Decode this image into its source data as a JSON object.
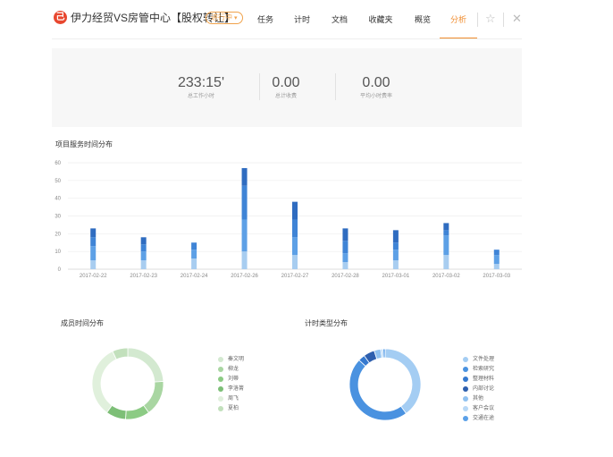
{
  "header": {
    "logo_text": "己",
    "title": "伊力经贸VS房管中心【股权转让】",
    "status": "进行中",
    "tabs": [
      {
        "label": "任务",
        "active": false
      },
      {
        "label": "计时",
        "active": false
      },
      {
        "label": "文档",
        "active": false
      },
      {
        "label": "收藏夹",
        "active": false
      },
      {
        "label": "概览",
        "active": false
      },
      {
        "label": "分析",
        "active": true
      }
    ],
    "star_icon": "star-icon",
    "close_icon": "close-icon"
  },
  "stats": [
    {
      "value": "233:15'",
      "label": "总工作小时"
    },
    {
      "value": "0.00",
      "label": "总计收费"
    },
    {
      "value": "0.00",
      "label": "平均小时费率"
    }
  ],
  "service_chart": {
    "title": "项目服务时间分布",
    "chart_data": {
      "type": "bar",
      "stacked": true,
      "categories": [
        "2017-02-22",
        "2017-02-23",
        "2017-02-24",
        "2017-02-26",
        "2017-02-27",
        "2017-02-28",
        "2017-03-01",
        "2017-03-02",
        "2017-03-03"
      ],
      "y_ticks": [
        0,
        10,
        20,
        30,
        40,
        50,
        60
      ],
      "ylim": [
        0,
        60
      ],
      "grid": true,
      "colors": [
        "#a8cdf0",
        "#5da0e6",
        "#3f84d6",
        "#2f6cc0"
      ],
      "series": [
        {
          "values": [
            5,
            5,
            6,
            10,
            8,
            4,
            5,
            8,
            3
          ]
        },
        {
          "values": [
            8,
            5,
            5,
            18,
            10,
            5,
            6,
            11,
            5
          ]
        },
        {
          "values": [
            5,
            4,
            4,
            19,
            10,
            7,
            4,
            3,
            3
          ]
        },
        {
          "values": [
            5,
            4,
            0,
            10,
            10,
            7,
            7,
            4,
            0
          ]
        }
      ]
    }
  },
  "member_chart": {
    "title": "成员时间分布",
    "chart_data": {
      "type": "pie",
      "donut": true,
      "categories": [
        "秦文明",
        "柳龙",
        "刘蒂",
        "李洛箐",
        "周飞",
        "夏柏"
      ],
      "values": [
        24,
        16,
        11,
        9,
        33,
        7
      ],
      "colors": [
        "#d3e9d0",
        "#a9d6a2",
        "#8ccb84",
        "#7dbf77",
        "#e0f0dc",
        "#c2e0bc"
      ]
    }
  },
  "type_chart": {
    "title": "计时类型分布",
    "chart_data": {
      "type": "pie",
      "donut": true,
      "categories": [
        "文件处理",
        "检索研究",
        "整理材料",
        "内部讨论",
        "其他",
        "客户会议",
        "交通在途"
      ],
      "values": [
        40,
        47,
        3,
        5,
        3,
        1,
        1
      ],
      "colors": [
        "#a4cdf3",
        "#4a92e0",
        "#3579cf",
        "#2e5fae",
        "#90c1f0",
        "#b8d8f6",
        "#5aa0e8"
      ]
    }
  }
}
